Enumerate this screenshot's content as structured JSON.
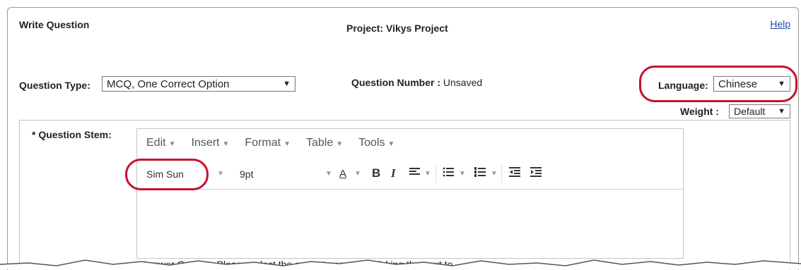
{
  "header": {
    "title": "Write Question",
    "project": "Project: Vikys Project",
    "help_link": "Help"
  },
  "question_type": {
    "label": "Question Type:",
    "value": "MCQ, One Correct Option"
  },
  "question_number": {
    "label": "Question Number :",
    "value": " Unsaved"
  },
  "language": {
    "label": "Language:",
    "value": "Chinese"
  },
  "weight": {
    "label": "Weight :",
    "value": "Default"
  },
  "question_stem": {
    "label": "* Question Stem:"
  },
  "editor": {
    "menus": [
      "Edit",
      "Insert",
      "Format",
      "Table",
      "Tools"
    ],
    "font_family": "Sim Sun",
    "font_size": "9pt",
    "text_color_glyph": "A",
    "bold_glyph": "B",
    "italic_glyph": "I"
  },
  "footer_partial": "Answer Options: Please select the correct answer by ticking the next to",
  "colors": {
    "highlight_oval": "#c8102e",
    "link": "#1a4fb0"
  },
  "icons": [
    "align-left-icon",
    "bullet-list-icon",
    "numbered-list-icon",
    "outdent-icon",
    "indent-icon"
  ]
}
